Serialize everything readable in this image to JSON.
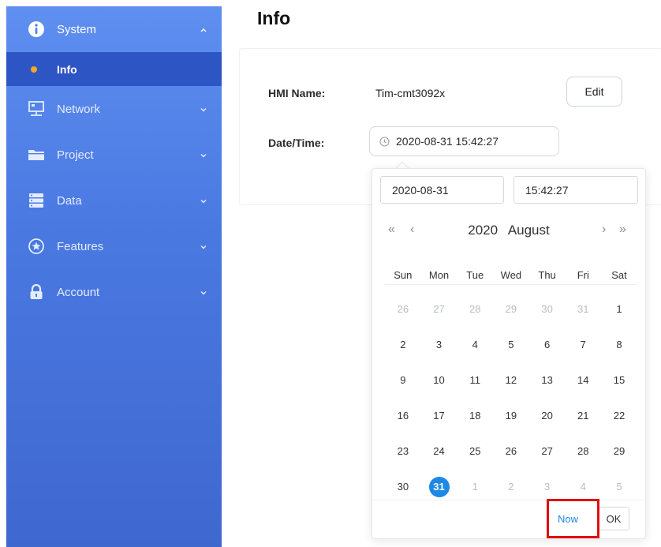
{
  "sidebar": {
    "system": {
      "label": "System",
      "icon": "info-circle-icon"
    },
    "info": {
      "label": "Info"
    },
    "network": {
      "label": "Network",
      "icon": "network-icon"
    },
    "project": {
      "label": "Project",
      "icon": "folder-icon"
    },
    "data": {
      "label": "Data",
      "icon": "database-icon"
    },
    "features": {
      "label": "Features",
      "icon": "star-circle-icon"
    },
    "account": {
      "label": "Account",
      "icon": "lock-icon"
    }
  },
  "page": {
    "title": "Info"
  },
  "info": {
    "hmi_label": "HMI Name:",
    "hmi_value": "Tim-cmt3092x",
    "edit_label": "Edit",
    "datetime_label": "Date/Time:",
    "datetime_value": "2020-08-31 15:42:27"
  },
  "picker": {
    "date_input": "2020-08-31",
    "time_input": "15:42:27",
    "year": "2020",
    "month": "August",
    "weekdays": [
      "Sun",
      "Mon",
      "Tue",
      "Wed",
      "Thu",
      "Fri",
      "Sat"
    ],
    "weeks": [
      [
        "26",
        "27",
        "28",
        "29",
        "30",
        "31",
        "1"
      ],
      [
        "2",
        "3",
        "4",
        "5",
        "6",
        "7",
        "8"
      ],
      [
        "9",
        "10",
        "11",
        "12",
        "13",
        "14",
        "15"
      ],
      [
        "16",
        "17",
        "18",
        "19",
        "20",
        "21",
        "22"
      ],
      [
        "23",
        "24",
        "25",
        "26",
        "27",
        "28",
        "29"
      ],
      [
        "30",
        "31",
        "1",
        "2",
        "3",
        "4",
        "5"
      ]
    ],
    "selected_day": "31",
    "now_label": "Now",
    "ok_label": "OK"
  },
  "colors": {
    "sidebar_top": "#5f8ff0",
    "sidebar_bottom": "#3f68cf",
    "active_submenu": "#2e55c4",
    "active_dot": "#f5a623",
    "accent": "#1e88e5",
    "highlight": "#e01010"
  }
}
